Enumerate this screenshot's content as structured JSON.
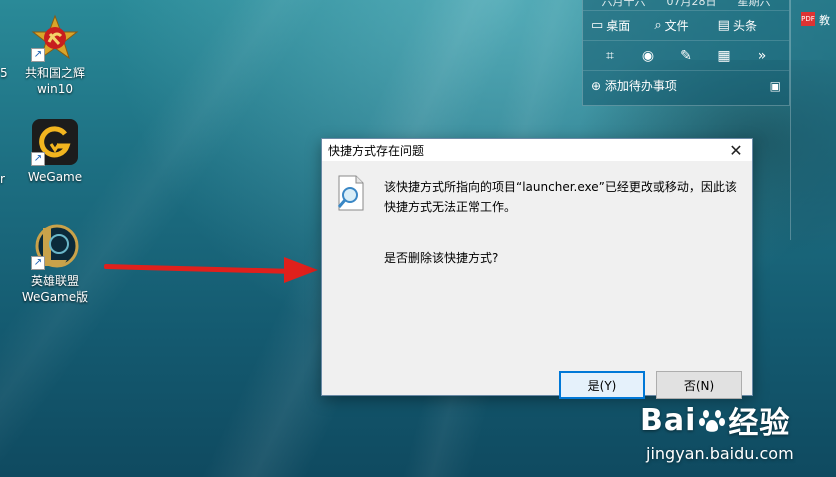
{
  "desktop": {
    "icons": [
      {
        "name": "republic-emblem",
        "label_line1": "共和国之辉",
        "label_line2": "win10"
      },
      {
        "name": "wegame",
        "label_line1": "WeGame",
        "label_line2": ""
      },
      {
        "name": "league",
        "label_line1": "英雄联盟",
        "label_line2": "WeGame版"
      }
    ],
    "left_edge_fragments": [
      "5",
      "r"
    ]
  },
  "widget": {
    "top_row": [
      "六月十六",
      "07月28日",
      "星期六"
    ],
    "row1": [
      {
        "icon": "desktop-icon",
        "label": "桌面"
      },
      {
        "icon": "search-icon",
        "label": "文件"
      },
      {
        "icon": "document-icon",
        "label": "头条"
      }
    ],
    "tools": [
      "crop-icon",
      "eye-icon",
      "edit-icon",
      "calculator-icon",
      "more-chevrons-icon"
    ],
    "todo_label": "添加待办事项",
    "side_text": "教"
  },
  "dialog": {
    "title": "快捷方式存在问题",
    "message": "该快捷方式所指向的项目“launcher.exe”已经更改或移动，因此该快捷方式无法正常工作。",
    "question": "是否删除该快捷方式?",
    "yes_label": "是(Y)",
    "no_label": "否(N)",
    "close_glyph": "✕"
  },
  "watermark": {
    "brand_left": "Bai",
    "brand_right": "经验",
    "url": "jingyan.baidu.com"
  },
  "colors": {
    "arrow": "#e0201c",
    "primary_button_border": "#0078d7"
  }
}
